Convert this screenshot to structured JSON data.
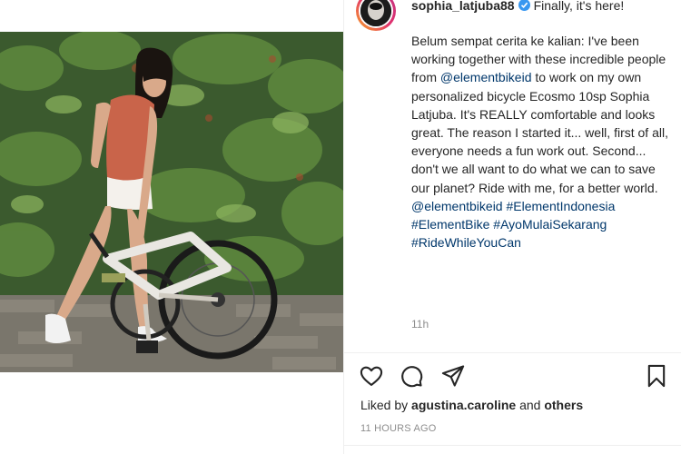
{
  "post": {
    "username": "sophia_latjuba88",
    "first_line": "Finally, it's here!",
    "caption_parts": [
      {
        "text": "Belum sempat cerita ke kalian: I've been working together with these incredible people from ",
        "link": false
      },
      {
        "text": "@elementbikeid",
        "link": true
      },
      {
        "text": " to work on my own personalized bicycle Ecosmo 10sp Sophia Latjuba. It's REALLY comfortable and looks great. The reason I started it... well, first of all, everyone needs a fun work out. Second... don't we all want to do what we can to save our planet? Ride with me, for a better world.",
        "link": false
      }
    ],
    "tags": [
      "@elementbikeid",
      "#ElementIndonesia",
      "#ElementBike",
      "#AyoMulaiSekarang",
      "#RideWhileYouCan"
    ],
    "comment_time": "11h",
    "liked_prefix": "Liked by",
    "liked_user": "agustina.caroline",
    "liked_and": "and",
    "liked_others": "others",
    "timestamp": "11 HOURS AGO"
  },
  "icons": {
    "like": "heart-icon",
    "comment": "comment-icon",
    "share": "paper-plane-icon",
    "save": "bookmark-icon",
    "verified": "verified-badge-icon"
  },
  "colors": {
    "text": "#262626",
    "link": "#00376b",
    "muted": "#8e8e8e",
    "verified": "#3897f0"
  }
}
